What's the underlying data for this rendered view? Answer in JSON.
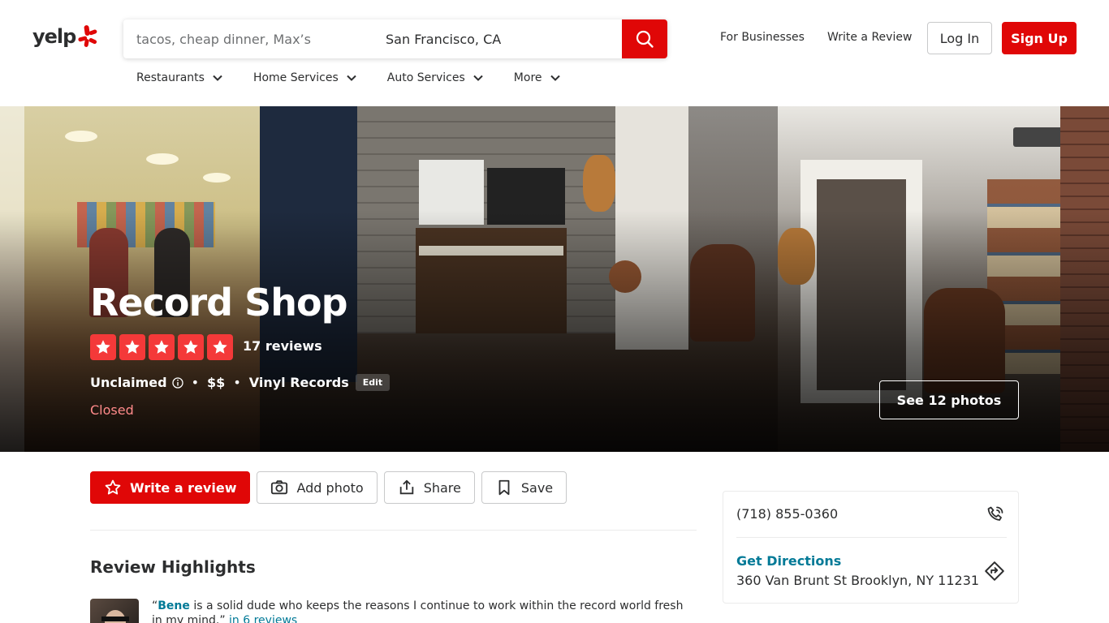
{
  "header": {
    "logo_text": "yelp",
    "search_placeholder": "tacos, cheap dinner, Max’s",
    "location_value": "San Francisco, CA",
    "for_businesses": "For Businesses",
    "write_review": "Write a Review",
    "login": "Log In",
    "signup": "Sign Up",
    "nav": [
      {
        "label": "Restaurants"
      },
      {
        "label": "Home Services"
      },
      {
        "label": "Auto Services"
      },
      {
        "label": "More"
      }
    ]
  },
  "business": {
    "name": "Record Shop",
    "rating": 5,
    "review_count": "17 reviews",
    "claimed": "Unclaimed",
    "price": "$$",
    "category": "Vinyl Records",
    "edit": "Edit",
    "status": "Closed",
    "see_photos": "See 12 photos"
  },
  "actions": {
    "write_review": "Write a review",
    "add_photo": "Add photo",
    "share": "Share",
    "save": "Save"
  },
  "review_highlights": {
    "title": "Review Highlights",
    "quote_open": "“",
    "quote_highlight": "Bene",
    "quote_text": " is a solid dude who keeps the reasons I continue to work within the record world fresh in my mind.” ",
    "quote_more": "in 6 reviews"
  },
  "sidebar": {
    "phone": "(718) 855-0360",
    "directions_label": "Get Directions",
    "address": "360 Van Brunt St Brooklyn, NY 11231"
  },
  "colors": {
    "brand_red": "#e00707",
    "star_red": "#f43939",
    "link_teal": "#027a97",
    "closed_red": "#ff8a8a"
  }
}
